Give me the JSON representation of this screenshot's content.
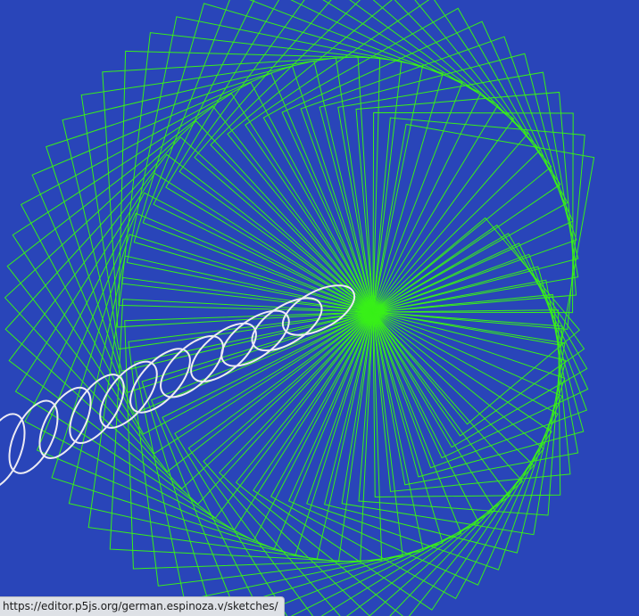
{
  "canvas": {
    "background_color": "#2945b9",
    "square_stroke_color": "#38f018",
    "ellipse_stroke_color": "#ecebf3"
  },
  "status_bar": {
    "url": "https://editor.p5js.org/german.espinoza.v/sketches/"
  }
}
